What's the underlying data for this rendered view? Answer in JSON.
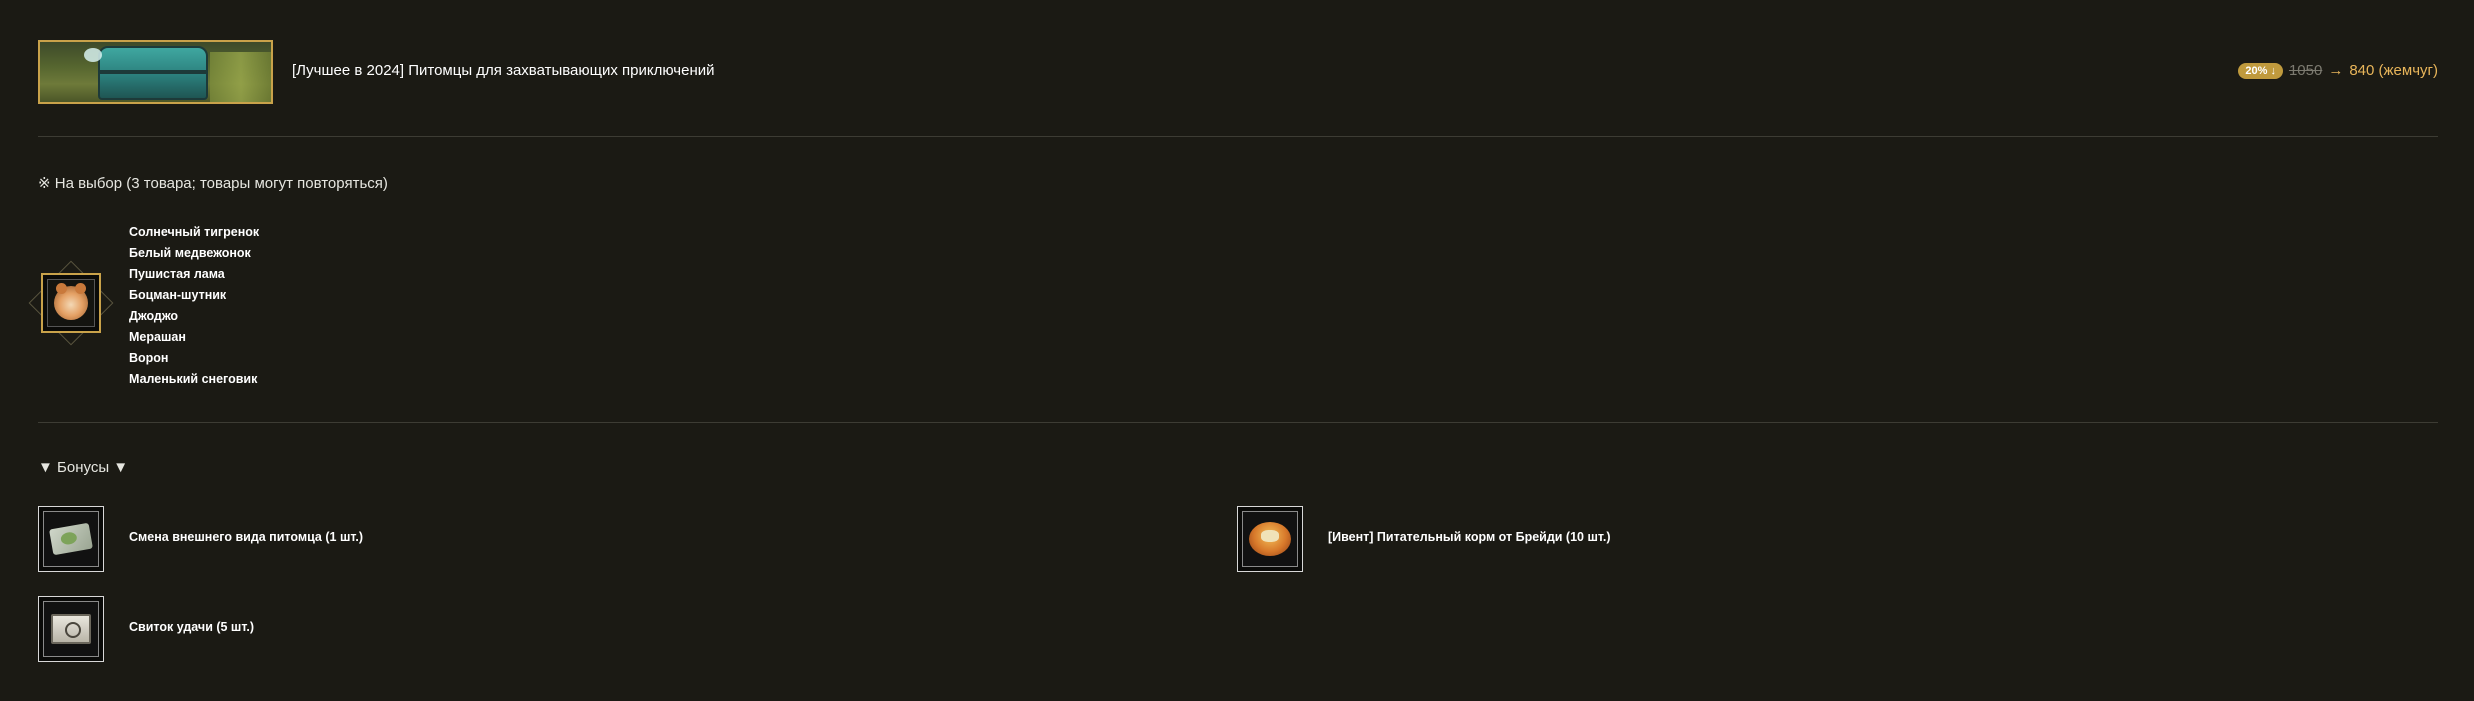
{
  "header": {
    "title": "[Лучшее в 2024] Питомцы для захватывающих приключений",
    "price": {
      "discount_badge": "20% ↓",
      "old_price": "1050",
      "arrow": "→",
      "new_price": "840 (жемчуг)"
    }
  },
  "selection": {
    "label": "※ На выбор (3 товара; товары могут повторяться)",
    "items": [
      "Солнечный тигренок",
      "Белый медвежонок",
      "Пушистая лама",
      "Боцман-шутник",
      "Джоджо",
      "Мерашан",
      "Ворон",
      "Маленький снеговик"
    ]
  },
  "bonuses": {
    "label": "▼ Бонусы ▼",
    "items": [
      {
        "label": "Смена внешнего вида питомца (1 шт.)",
        "icon": "appearance-ticket-icon"
      },
      {
        "label": "[Ивент] Питательный корм от Брейди (10 шт.)",
        "icon": "pet-food-icon"
      },
      {
        "label": "Свиток удачи (5 шт.)",
        "icon": "luck-scroll-icon"
      }
    ]
  },
  "colors": {
    "background": "#1b1a14",
    "accent_gold": "#c9a24a",
    "price_highlight": "#e8b55a",
    "old_price": "#7c7a70"
  }
}
